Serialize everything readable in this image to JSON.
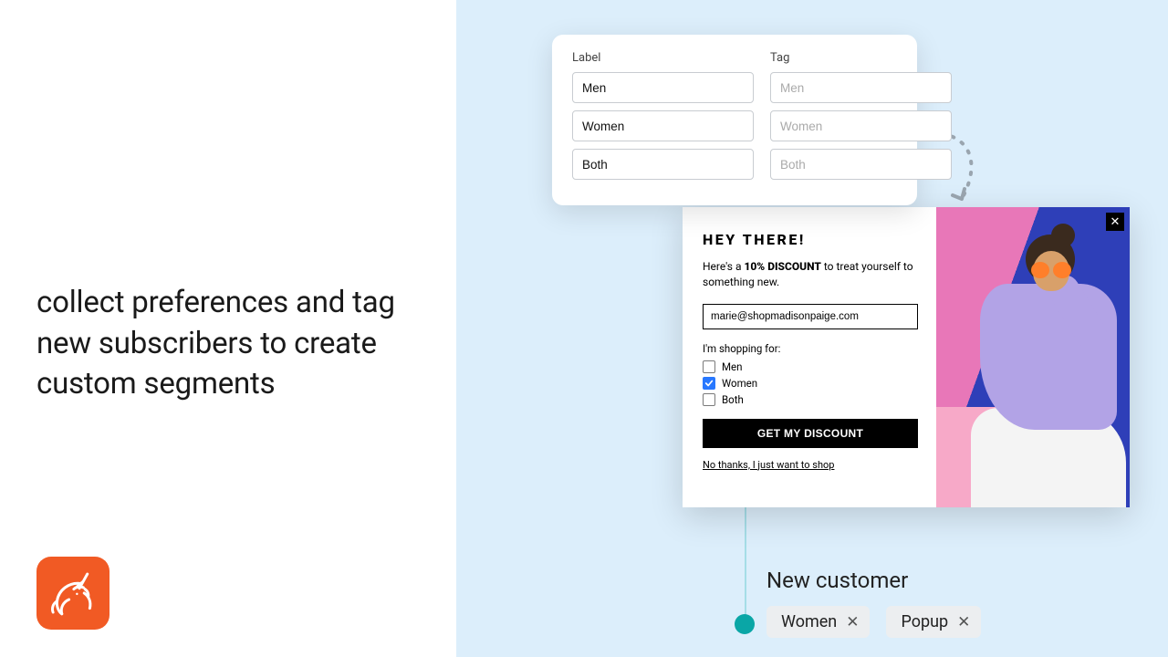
{
  "left": {
    "headline": "collect preferences and tag new subscribers to create custom segments"
  },
  "panel": {
    "label_header": "Label",
    "tag_header": "Tag",
    "rows": [
      {
        "label": "Men",
        "tag_placeholder": "Men"
      },
      {
        "label": "Women",
        "tag_placeholder": "Women"
      },
      {
        "label": "Both",
        "tag_placeholder": "Both"
      }
    ]
  },
  "popup": {
    "title": "HEY THERE!",
    "sub_pre": "Here's a ",
    "sub_bold": "10% DISCOUNT",
    "sub_post": " to treat yourself to something new.",
    "email": "marie@shopmadisonpaige.com",
    "question": "I'm shopping for:",
    "options": [
      {
        "label": "Men",
        "checked": false
      },
      {
        "label": "Women",
        "checked": true
      },
      {
        "label": "Both",
        "checked": false
      }
    ],
    "cta": "GET MY DISCOUNT",
    "decline": "No thanks, I just want to shop"
  },
  "newcust": {
    "title": "New customer",
    "chips": [
      "Women",
      "Popup"
    ]
  },
  "colors": {
    "brand_orange": "#f15a24",
    "bg_blue": "#dceefb",
    "accent_teal": "#0aa6a6",
    "checkbox_blue": "#2878ff"
  }
}
